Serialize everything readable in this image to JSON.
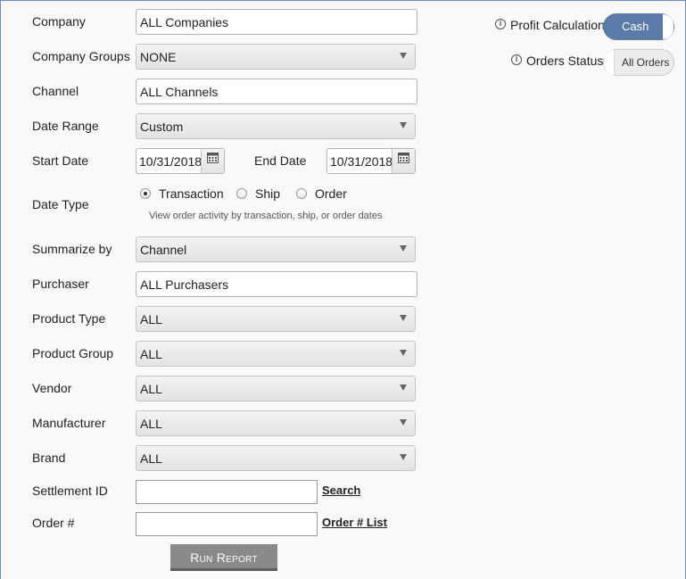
{
  "form": {
    "company": {
      "label": "Company",
      "value": "ALL Companies"
    },
    "company_groups": {
      "label": "Company Groups",
      "value": "NONE"
    },
    "channel": {
      "label": "Channel",
      "value": "ALL Channels"
    },
    "date_range": {
      "label": "Date Range",
      "value": "Custom"
    },
    "start_date": {
      "label": "Start Date",
      "value": "10/31/2018"
    },
    "end_date": {
      "label": "End Date",
      "value": "10/31/2018"
    },
    "date_type": {
      "label": "Date Type",
      "options": [
        "Transaction",
        "Ship",
        "Order"
      ],
      "selected": "Transaction",
      "hint": "View order activity by transaction, ship, or order dates"
    },
    "summarize_by": {
      "label": "Summarize by",
      "value": "Channel"
    },
    "purchaser": {
      "label": "Purchaser",
      "value": "ALL Purchasers"
    },
    "product_type": {
      "label": "Product Type",
      "value": "ALL"
    },
    "product_group": {
      "label": "Product Group",
      "value": "ALL"
    },
    "vendor": {
      "label": "Vendor",
      "value": "ALL"
    },
    "manufacturer": {
      "label": "Manufacturer",
      "value": "ALL"
    },
    "brand": {
      "label": "Brand",
      "value": "ALL"
    },
    "settlement_id": {
      "label": "Settlement ID",
      "value": "",
      "link": "Search"
    },
    "order_num": {
      "label": "Order #",
      "value": "",
      "link": "Order # List"
    },
    "run_button": "Run Report"
  },
  "toggles": {
    "profit_calc": {
      "label": "Profit Calculation",
      "value": "Cash"
    },
    "orders_status": {
      "label": "Orders Status",
      "value": "All Orders"
    }
  },
  "icons": {
    "info": "info-icon",
    "calendar": "calendar-icon",
    "dropdown": "chevron-down-icon"
  },
  "colors": {
    "toggle_active": "#5a7aa8",
    "button": "#8a8a8a",
    "frame": "#6a8fc7"
  }
}
